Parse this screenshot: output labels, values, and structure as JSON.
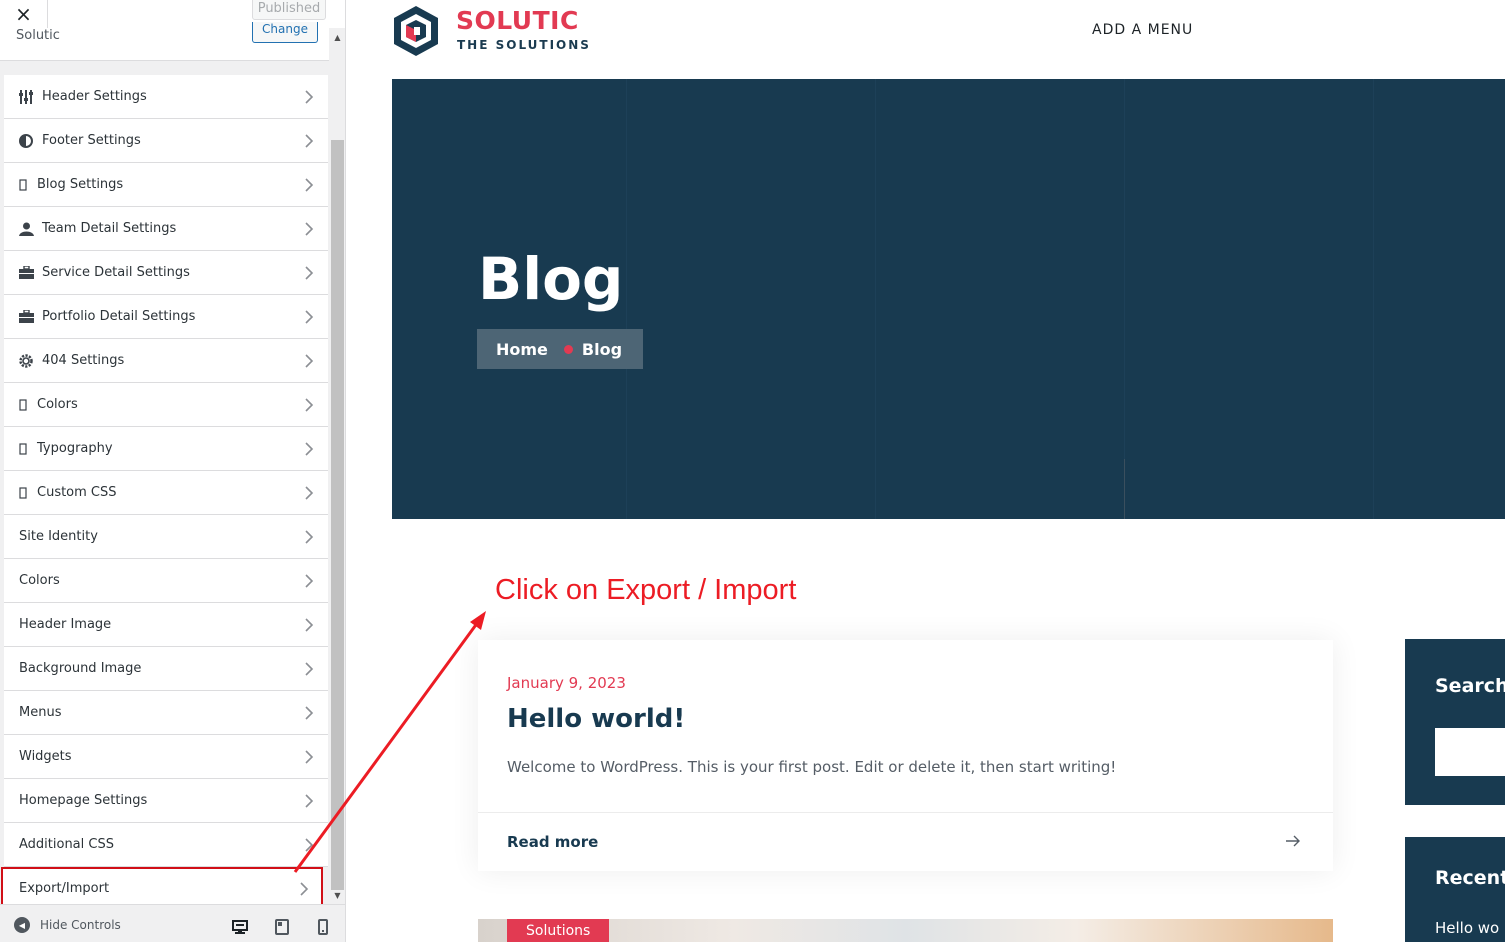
{
  "sidebar": {
    "close_label": "×",
    "status_label": "Published",
    "theme_name": "Solutic",
    "change_label": "Change",
    "items": [
      {
        "label": "Header Settings",
        "icon": "sliders-icon"
      },
      {
        "label": "Footer Settings",
        "icon": "half-circle-icon"
      },
      {
        "label": "Blog Settings",
        "icon": "rectangle-icon"
      },
      {
        "label": "Team Detail Settings",
        "icon": "person-icon"
      },
      {
        "label": "Service Detail Settings",
        "icon": "briefcase-icon"
      },
      {
        "label": "Portfolio Detail Settings",
        "icon": "briefcase-icon"
      },
      {
        "label": "404 Settings",
        "icon": "gear-icon"
      },
      {
        "label": "Colors",
        "icon": "rectangle-icon"
      },
      {
        "label": "Typography",
        "icon": "rectangle-icon"
      },
      {
        "label": "Custom CSS",
        "icon": "rectangle-icon"
      },
      {
        "label": "Site Identity"
      },
      {
        "label": "Colors"
      },
      {
        "label": "Header Image"
      },
      {
        "label": "Background Image"
      },
      {
        "label": "Menus"
      },
      {
        "label": "Widgets"
      },
      {
        "label": "Homepage Settings"
      },
      {
        "label": "Additional CSS"
      },
      {
        "label": "Export/Import",
        "highlighted": true
      }
    ],
    "footer": {
      "hide_controls_label": "Hide Controls"
    }
  },
  "preview": {
    "logo": {
      "title": "SOLUTIC",
      "subtitle": "THE SOLUTIONS"
    },
    "menu_label": "ADD A MENU",
    "hero": {
      "title": "Blog",
      "breadcrumb": {
        "home": "Home",
        "current": "Blog"
      }
    },
    "annotation": "Click on Export / Import",
    "post": {
      "date": "January 9, 2023",
      "title": "Hello world!",
      "excerpt": "Welcome to WordPress. This is your first post. Edit or delete it, then start writing!",
      "read_more": "Read more"
    },
    "next_post_category": "Solutions",
    "widgets": {
      "search_title": "Search",
      "recent_title": "Recent",
      "recent_item": "Hello wo"
    }
  },
  "colors": {
    "brand_red": "#e23a52",
    "navy": "#183a50",
    "annotation_red": "#ec1c24"
  }
}
